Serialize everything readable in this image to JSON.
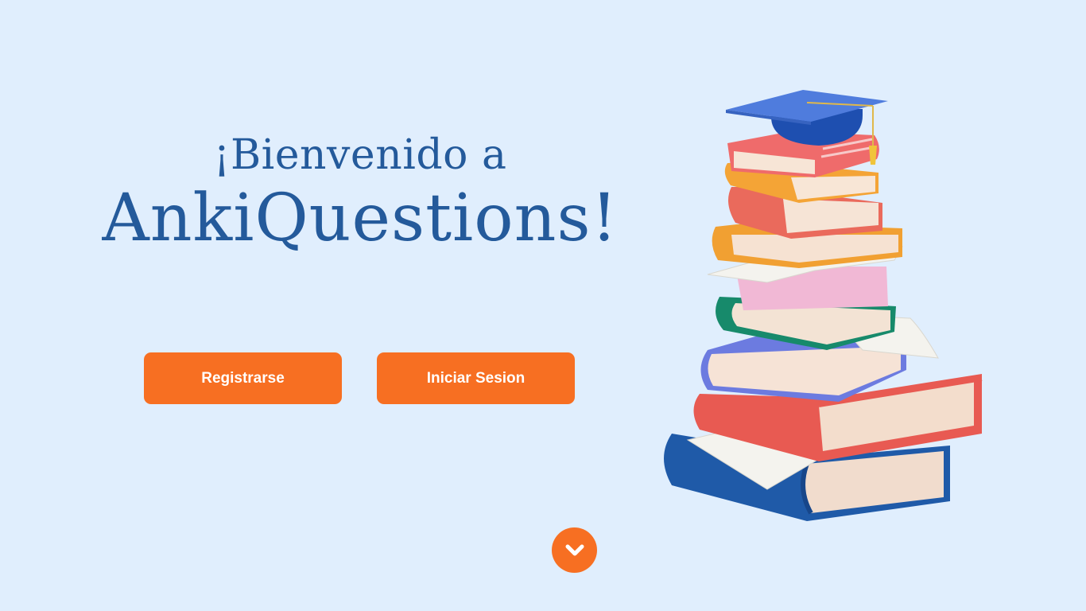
{
  "hero": {
    "welcome_line": "¡Bienvenido a",
    "app_name": "AnkiQuestions!"
  },
  "actions": {
    "register_label": "Registrarse",
    "login_label": "Iniciar Sesion"
  },
  "scroll": {
    "icon": "chevron-down-icon"
  },
  "illustration": {
    "subject": "stack-of-books-with-graduation-cap"
  },
  "colors": {
    "background": "#e0eefd",
    "title": "#245a9b",
    "accent": "#f76f22",
    "button_text": "#ffffff"
  }
}
